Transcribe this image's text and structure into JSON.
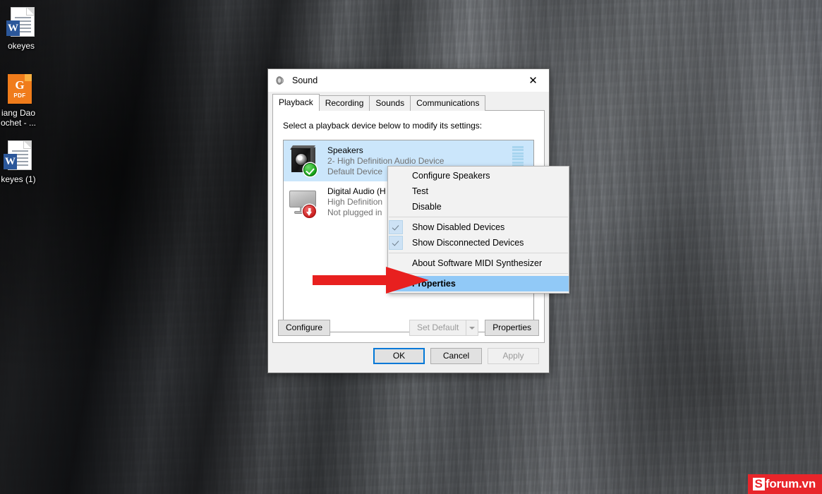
{
  "desktop": {
    "icons": [
      {
        "name": "okeyes",
        "label": "okeyes",
        "type": "word-document-icon",
        "badge": "W"
      },
      {
        "name": "giang-dao-crochet",
        "label": "iang Dao\nochet - ...",
        "type": "pdf-document-icon",
        "badge": "PDF",
        "glyph": "G"
      },
      {
        "name": "okeyes-1",
        "label": "keyes (1)",
        "type": "word-document-icon",
        "badge": "W"
      }
    ]
  },
  "dialog": {
    "title": "Sound",
    "title_icon": "speaker-icon",
    "close_label": "✕",
    "tabs": [
      {
        "label": "Playback",
        "active": true
      },
      {
        "label": "Recording",
        "active": false
      },
      {
        "label": "Sounds",
        "active": false
      },
      {
        "label": "Communications",
        "active": false
      }
    ],
    "instruction": "Select a playback device below to modify its settings:",
    "devices": [
      {
        "name": "Speakers",
        "description": "2- High Definition Audio Device",
        "status": "Default Device",
        "icon": "speaker-icon",
        "badge": "green-check-icon",
        "selected": true,
        "meter_segments": 10
      },
      {
        "name": "Digital Audio (H",
        "description": "High Definition",
        "status": "Not plugged in",
        "icon": "monitor-icon",
        "badge": "red-down-arrow-icon",
        "selected": false,
        "meter_segments": 0
      }
    ],
    "buttons": {
      "configure": "Configure",
      "set_default": "Set Default",
      "properties_inner": "Properties",
      "ok": "OK",
      "cancel": "Cancel",
      "apply": "Apply"
    },
    "button_states": {
      "configure": "enabled",
      "set_default": "disabled",
      "properties_inner": "enabled",
      "ok": "default-focused",
      "cancel": "enabled",
      "apply": "disabled"
    }
  },
  "context_menu": {
    "items": [
      {
        "label": "Configure Speakers",
        "checked": false,
        "highlighted": false,
        "separator_after": false
      },
      {
        "label": "Test",
        "checked": false,
        "highlighted": false,
        "separator_after": false
      },
      {
        "label": "Disable",
        "checked": false,
        "highlighted": false,
        "separator_after": true
      },
      {
        "label": "Show Disabled Devices",
        "checked": true,
        "highlighted": false,
        "separator_after": false
      },
      {
        "label": "Show Disconnected Devices",
        "checked": true,
        "highlighted": false,
        "separator_after": true
      },
      {
        "label": "About Software MIDI Synthesizer",
        "checked": false,
        "highlighted": false,
        "separator_after": true
      },
      {
        "label": "Properties",
        "checked": false,
        "highlighted": true,
        "separator_after": false
      }
    ]
  },
  "annotation": {
    "arrow": "red-right-arrow",
    "color": "#e8201f",
    "points_to": "Properties"
  },
  "watermark": {
    "initial": "S",
    "rest": "forum.vn",
    "background": "#e8252a"
  },
  "colors": {
    "selection_blue": "#cbe6fb",
    "menu_highlight": "#91c9f7",
    "accent_blue": "#0078d7",
    "annotation_red": "#e8201f"
  }
}
